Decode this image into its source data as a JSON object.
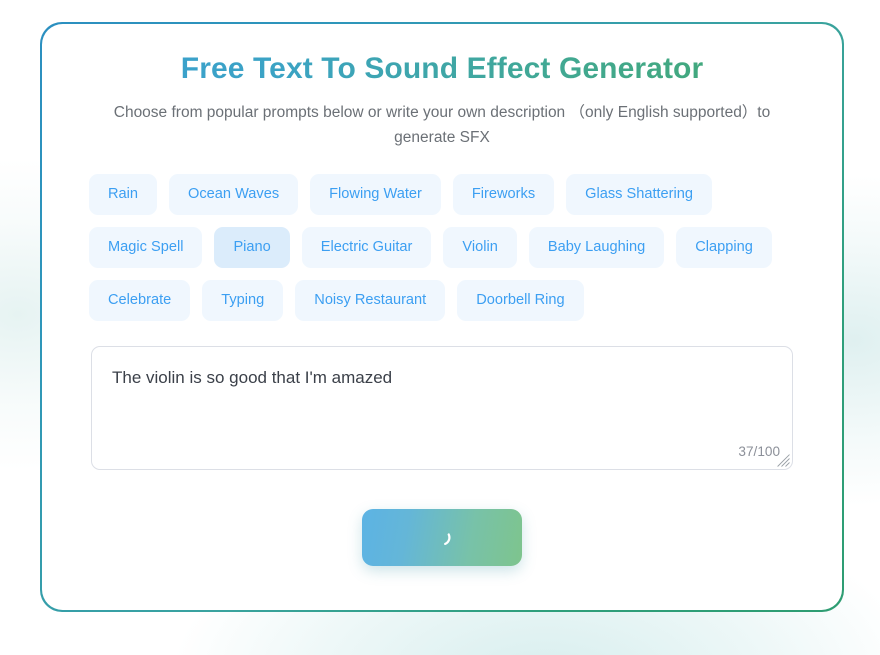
{
  "page": {
    "title": "Free Text To Sound Effect Generator",
    "subtitle": "Choose from popular prompts below or write your own description （only English supported）to generate SFX"
  },
  "prompt_tags": [
    {
      "label": "Rain",
      "active": false
    },
    {
      "label": "Ocean Waves",
      "active": false
    },
    {
      "label": "Flowing Water",
      "active": false
    },
    {
      "label": "Fireworks",
      "active": false
    },
    {
      "label": "Glass Shattering",
      "active": false
    },
    {
      "label": "Magic Spell",
      "active": false
    },
    {
      "label": "Piano",
      "active": true
    },
    {
      "label": "Electric Guitar",
      "active": false
    },
    {
      "label": "Violin",
      "active": false
    },
    {
      "label": "Baby Laughing",
      "active": false
    },
    {
      "label": "Clapping",
      "active": false
    },
    {
      "label": "Celebrate",
      "active": false
    },
    {
      "label": "Typing",
      "active": false
    },
    {
      "label": "Noisy Restaurant",
      "active": false
    },
    {
      "label": "Doorbell Ring",
      "active": false
    }
  ],
  "prompt_input": {
    "value": "The violin is so good that I'm amazed",
    "placeholder": "",
    "counter": "37/100",
    "char_count": 37,
    "char_limit": 100
  },
  "generate_button": {
    "label": "",
    "state": "loading",
    "spinner_icon": "loading-spinner-icon"
  },
  "colors": {
    "title_gradient_start": "#3b9fd4",
    "title_gradient_end": "#43a96b",
    "tag_text": "#3c9ff2",
    "tag_bg": "#f0f7fe",
    "tag_bg_active": "#dbecfb",
    "card_border_start": "#2b8fc0",
    "card_border_end": "#2e9d72",
    "button_gradient_start": "#5cb3e4",
    "button_gradient_end": "#7ec48d",
    "subtitle_text": "#6b7076",
    "input_text": "#3b4049",
    "counter_text": "#8c9099",
    "input_border": "#dcdfe6"
  }
}
